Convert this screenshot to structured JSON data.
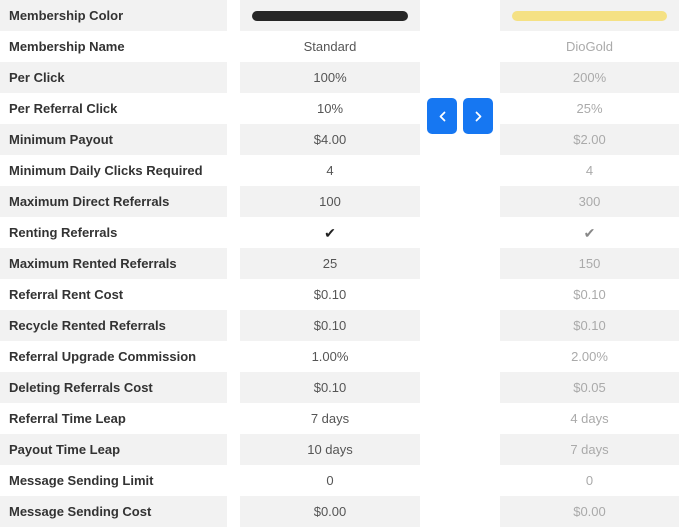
{
  "table": {
    "row_labels": [
      "Membership Color",
      "Membership Name",
      "Per Click",
      "Per Referral Click",
      "Minimum Payout",
      "Minimum Daily Clicks Required",
      "Maximum Direct Referrals",
      "Renting Referrals",
      "Maximum Rented Referrals",
      "Referral Rent Cost",
      "Recycle Rented Referrals",
      "Referral Upgrade Commission",
      "Deleting Referrals Cost",
      "Referral Time Leap",
      "Payout Time Leap",
      "Message Sending Limit",
      "Message Sending Cost"
    ],
    "columns": [
      {
        "name": "Standard",
        "color_hex": "#262626",
        "state": "active",
        "values": [
          "",
          "Standard",
          "100%",
          "10%",
          "$4.00",
          "4",
          "100",
          "✔",
          "25",
          "$0.10",
          "$0.10",
          "1.00%",
          "$0.10",
          "7 days",
          "10 days",
          "0",
          "$0.00"
        ]
      },
      {
        "name": "DioGold",
        "color_hex": "#f5e184",
        "state": "dimmed",
        "values": [
          "",
          "DioGold",
          "200%",
          "25%",
          "$2.00",
          "4",
          "300",
          "✔",
          "150",
          "$0.10",
          "$0.10",
          "2.00%",
          "$0.05",
          "4 days",
          "7 days",
          "0",
          "$0.00"
        ]
      }
    ]
  },
  "nav": {
    "prev_label": "‹",
    "next_label": "›",
    "prev_icon": "chevron-left-icon",
    "next_icon": "chevron-right-icon",
    "accent_hex": "#1677f2"
  }
}
